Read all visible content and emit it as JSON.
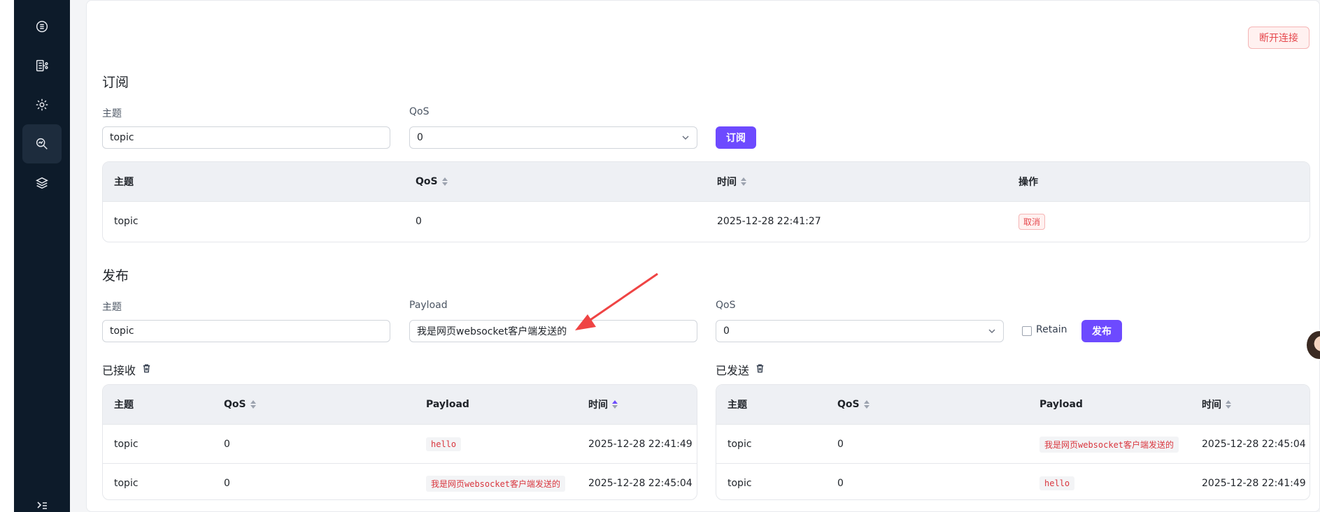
{
  "header": {
    "disconnect_label": "断开连接"
  },
  "subscribe": {
    "title": "订阅",
    "topic_label": "主题",
    "topic_value": "topic",
    "qos_label": "QoS",
    "qos_value": "0",
    "button_label": "订阅",
    "table": {
      "headers": [
        "主题",
        "QoS",
        "时间",
        "操作"
      ],
      "rows": [
        {
          "topic": "topic",
          "qos": "0",
          "time": "2025-12-28 22:41:27",
          "action": "取消"
        }
      ]
    }
  },
  "publish": {
    "title": "发布",
    "topic_label": "主题",
    "topic_value": "topic",
    "payload_label": "Payload",
    "payload_value": "我是网页websocket客户端发送的",
    "qos_label": "QoS",
    "qos_value": "0",
    "retain_label": "Retain",
    "retain_checked": false,
    "button_label": "发布"
  },
  "received": {
    "title": "已接收",
    "headers": [
      "主题",
      "QoS",
      "Payload",
      "时间"
    ],
    "rows": [
      {
        "topic": "topic",
        "qos": "0",
        "payload": "hello",
        "time": "2025-12-28 22:41:49"
      },
      {
        "topic": "topic",
        "qos": "0",
        "payload": "我是网页websocket客户端发送的",
        "time": "2025-12-28 22:45:04"
      }
    ]
  },
  "sent": {
    "title": "已发送",
    "headers": [
      "主题",
      "QoS",
      "Payload",
      "时间"
    ],
    "rows": [
      {
        "topic": "topic",
        "qos": "0",
        "payload": "我是网页websocket客户端发送的",
        "time": "2025-12-28 22:45:04"
      },
      {
        "topic": "topic",
        "qos": "0",
        "payload": "hello",
        "time": "2025-12-28 22:41:49"
      }
    ]
  },
  "sidebar": {
    "items": [
      {
        "icon": "dashboard-icon",
        "active": false
      },
      {
        "icon": "topology-icon",
        "active": false
      },
      {
        "icon": "settings-icon",
        "active": false
      },
      {
        "icon": "websocket-test-icon",
        "active": true
      },
      {
        "icon": "layers-icon",
        "active": false
      }
    ]
  },
  "colors": {
    "accent": "#6d4aff",
    "danger": "#e5484d",
    "sidebar_bg": "#0d1b2a",
    "annotation_arrow": "#ef4444"
  }
}
